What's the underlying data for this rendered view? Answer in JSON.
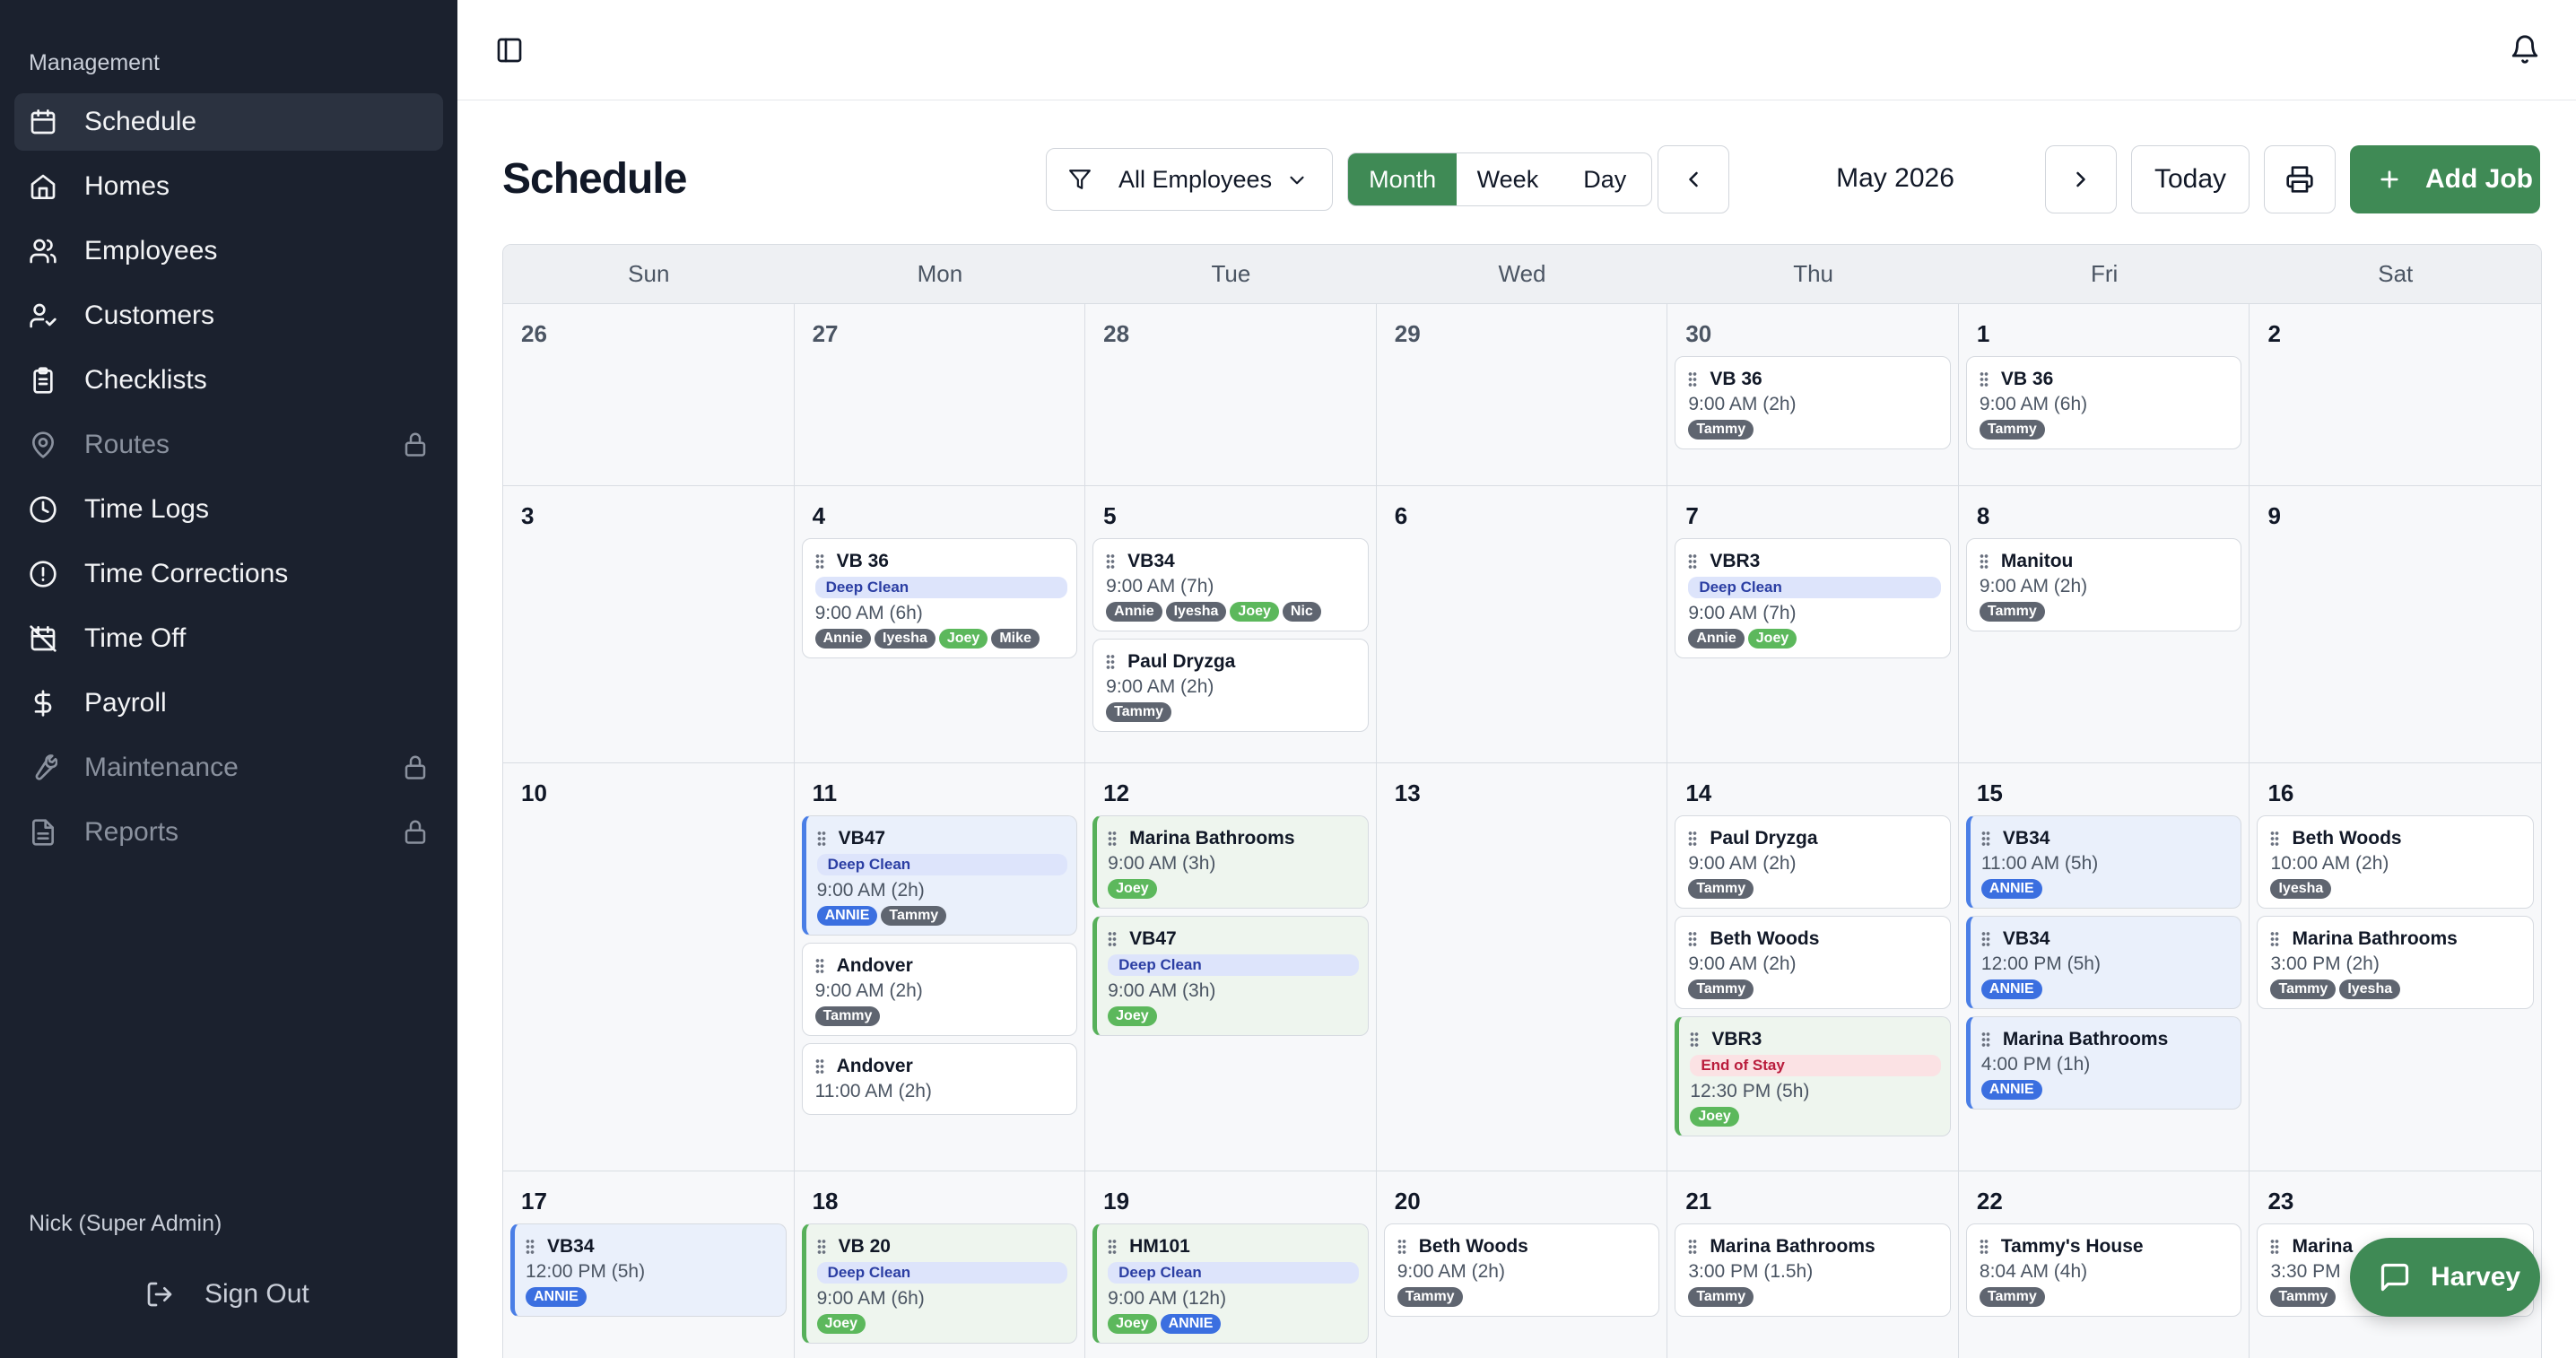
{
  "sidebar": {
    "section": "Management",
    "items": [
      {
        "label": "Schedule",
        "icon": "calendar-icon",
        "active": true,
        "locked": false
      },
      {
        "label": "Homes",
        "icon": "home-icon",
        "active": false,
        "locked": false
      },
      {
        "label": "Employees",
        "icon": "users-icon",
        "active": false,
        "locked": false
      },
      {
        "label": "Customers",
        "icon": "user-check-icon",
        "active": false,
        "locked": false
      },
      {
        "label": "Checklists",
        "icon": "clipboard-icon",
        "active": false,
        "locked": false
      },
      {
        "label": "Routes",
        "icon": "map-pin-icon",
        "active": false,
        "locked": true
      },
      {
        "label": "Time Logs",
        "icon": "clock-icon",
        "active": false,
        "locked": false
      },
      {
        "label": "Time Corrections",
        "icon": "alert-circle-icon",
        "active": false,
        "locked": false
      },
      {
        "label": "Time Off",
        "icon": "calendar-off-icon",
        "active": false,
        "locked": false
      },
      {
        "label": "Payroll",
        "icon": "dollar-icon",
        "active": false,
        "locked": false
      },
      {
        "label": "Maintenance",
        "icon": "wrench-icon",
        "active": false,
        "locked": true
      },
      {
        "label": "Reports",
        "icon": "file-text-icon",
        "active": false,
        "locked": true
      }
    ],
    "user": "Nick (Super Admin)",
    "sign_out": "Sign Out"
  },
  "header": {
    "title": "Schedule",
    "filter_label": "All Employees",
    "views": [
      "Month",
      "Week",
      "Day"
    ],
    "active_view": "Month",
    "period": "May 2026",
    "today_label": "Today",
    "add_job_label": "Add Job"
  },
  "calendar": {
    "weekdays": [
      "Sun",
      "Mon",
      "Tue",
      "Wed",
      "Thu",
      "Fri",
      "Sat"
    ],
    "weeks": [
      {
        "days": [
          {
            "num": "26",
            "other": true,
            "events": []
          },
          {
            "num": "27",
            "other": true,
            "events": []
          },
          {
            "num": "28",
            "other": true,
            "events": []
          },
          {
            "num": "29",
            "other": true,
            "events": []
          },
          {
            "num": "30",
            "other": true,
            "events": [
              {
                "title": "VB 36",
                "time": "9:00 AM (2h)",
                "tags": [
                  {
                    "name": "Tammy",
                    "color": "gray"
                  }
                ]
              }
            ]
          },
          {
            "num": "1",
            "events": [
              {
                "title": "VB 36",
                "time": "9:00 AM (6h)",
                "tags": [
                  {
                    "name": "Tammy",
                    "color": "gray"
                  }
                ]
              }
            ]
          },
          {
            "num": "2",
            "events": []
          }
        ]
      },
      {
        "days": [
          {
            "num": "3",
            "events": []
          },
          {
            "num": "4",
            "events": [
              {
                "title": "VB 36",
                "type": "Deep Clean",
                "type_style": "deep",
                "time": "9:00 AM (6h)",
                "tags": [
                  {
                    "name": "Annie",
                    "color": "gray"
                  },
                  {
                    "name": "Iyesha",
                    "color": "gray"
                  },
                  {
                    "name": "Joey",
                    "color": "green"
                  },
                  {
                    "name": "Mike",
                    "color": "gray"
                  }
                ]
              }
            ]
          },
          {
            "num": "5",
            "events": [
              {
                "title": "VB34",
                "time": "9:00 AM (7h)",
                "tags": [
                  {
                    "name": "Annie",
                    "color": "gray"
                  },
                  {
                    "name": "Iyesha",
                    "color": "gray"
                  },
                  {
                    "name": "Joey",
                    "color": "green"
                  },
                  {
                    "name": "Nic",
                    "color": "gray"
                  }
                ]
              },
              {
                "title": "Paul Dryzga",
                "time": "9:00 AM (2h)",
                "tags": [
                  {
                    "name": "Tammy",
                    "color": "gray"
                  }
                ]
              }
            ]
          },
          {
            "num": "6",
            "events": []
          },
          {
            "num": "7",
            "events": [
              {
                "title": "VBR3",
                "type": "Deep Clean",
                "type_style": "deep",
                "time": "9:00 AM (7h)",
                "tags": [
                  {
                    "name": "Annie",
                    "color": "gray"
                  },
                  {
                    "name": "Joey",
                    "color": "green"
                  }
                ]
              }
            ]
          },
          {
            "num": "8",
            "events": [
              {
                "title": "Manitou",
                "time": "9:00 AM (2h)",
                "tags": [
                  {
                    "name": "Tammy",
                    "color": "gray"
                  }
                ]
              }
            ]
          },
          {
            "num": "9",
            "events": []
          }
        ]
      },
      {
        "days": [
          {
            "num": "10",
            "events": []
          },
          {
            "num": "11",
            "events": [
              {
                "title": "VB47",
                "type": "Deep Clean",
                "type_style": "deep",
                "time": "9:00 AM (2h)",
                "style": "blue",
                "tags": [
                  {
                    "name": "ANNIE",
                    "color": "blue"
                  },
                  {
                    "name": "Tammy",
                    "color": "gray"
                  }
                ]
              },
              {
                "title": "Andover",
                "time": "9:00 AM (2h)",
                "tags": [
                  {
                    "name": "Tammy",
                    "color": "gray"
                  }
                ]
              },
              {
                "title": "Andover",
                "time": "11:00 AM (2h)",
                "tags": []
              }
            ]
          },
          {
            "num": "12",
            "events": [
              {
                "title": "Marina Bathrooms",
                "time": "9:00 AM (3h)",
                "style": "green",
                "tags": [
                  {
                    "name": "Joey",
                    "color": "green"
                  }
                ]
              },
              {
                "title": "VB47",
                "type": "Deep Clean",
                "type_style": "deep",
                "time": "9:00 AM (3h)",
                "style": "green",
                "tags": [
                  {
                    "name": "Joey",
                    "color": "green"
                  }
                ]
              }
            ]
          },
          {
            "num": "13",
            "events": []
          },
          {
            "num": "14",
            "events": [
              {
                "title": "Paul Dryzga",
                "time": "9:00 AM (2h)",
                "tags": [
                  {
                    "name": "Tammy",
                    "color": "gray"
                  }
                ]
              },
              {
                "title": "Beth Woods",
                "time": "9:00 AM (2h)",
                "tags": [
                  {
                    "name": "Tammy",
                    "color": "gray"
                  }
                ]
              },
              {
                "title": "VBR3",
                "type": "End of Stay",
                "type_style": "stay",
                "time": "12:30 PM (5h)",
                "style": "green",
                "tags": [
                  {
                    "name": "Joey",
                    "color": "green"
                  }
                ]
              }
            ]
          },
          {
            "num": "15",
            "events": [
              {
                "title": "VB34",
                "time": "11:00 AM (5h)",
                "style": "blue",
                "tags": [
                  {
                    "name": "ANNIE",
                    "color": "blue"
                  }
                ]
              },
              {
                "title": "VB34",
                "time": "12:00 PM (5h)",
                "style": "blue",
                "tags": [
                  {
                    "name": "ANNIE",
                    "color": "blue"
                  }
                ]
              },
              {
                "title": "Marina Bathrooms",
                "time": "4:00 PM (1h)",
                "style": "blue",
                "tags": [
                  {
                    "name": "ANNIE",
                    "color": "blue"
                  }
                ]
              }
            ]
          },
          {
            "num": "16",
            "events": [
              {
                "title": "Beth Woods",
                "time": "10:00 AM (2h)",
                "tags": [
                  {
                    "name": "Iyesha",
                    "color": "gray"
                  }
                ]
              },
              {
                "title": "Marina Bathrooms",
                "time": "3:00 PM (2h)",
                "tags": [
                  {
                    "name": "Tammy",
                    "color": "gray"
                  },
                  {
                    "name": "Iyesha",
                    "color": "gray"
                  }
                ]
              }
            ]
          }
        ]
      },
      {
        "days": [
          {
            "num": "17",
            "events": [
              {
                "title": "VB34",
                "time": "12:00 PM (5h)",
                "style": "blue",
                "tags": [
                  {
                    "name": "ANNIE",
                    "color": "blue"
                  }
                ]
              }
            ]
          },
          {
            "num": "18",
            "events": [
              {
                "title": "VB 20",
                "type": "Deep Clean",
                "type_style": "deep",
                "time": "9:00 AM (6h)",
                "style": "green",
                "tags": [
                  {
                    "name": "Joey",
                    "color": "green"
                  }
                ]
              }
            ]
          },
          {
            "num": "19",
            "events": [
              {
                "title": "HM101",
                "type": "Deep Clean",
                "type_style": "deep",
                "time": "9:00 AM (12h)",
                "style": "green",
                "tags": [
                  {
                    "name": "Joey",
                    "color": "green"
                  },
                  {
                    "name": "ANNIE",
                    "color": "blue"
                  }
                ]
              }
            ]
          },
          {
            "num": "20",
            "events": [
              {
                "title": "Beth Woods",
                "time": "9:00 AM (2h)",
                "tags": [
                  {
                    "name": "Tammy",
                    "color": "gray"
                  }
                ]
              }
            ]
          },
          {
            "num": "21",
            "events": [
              {
                "title": "Marina Bathrooms",
                "time": "3:00 PM (1.5h)",
                "tags": [
                  {
                    "name": "Tammy",
                    "color": "gray"
                  }
                ]
              }
            ]
          },
          {
            "num": "22",
            "events": [
              {
                "title": "Tammy's House",
                "time": "8:04 AM (4h)",
                "tags": [
                  {
                    "name": "Tammy",
                    "color": "gray"
                  }
                ]
              }
            ]
          },
          {
            "num": "23",
            "events": [
              {
                "title": "Marina",
                "time": "3:30 PM",
                "tags": [
                  {
                    "name": "Tammy",
                    "color": "gray"
                  }
                ]
              }
            ]
          }
        ]
      }
    ]
  },
  "assistant": {
    "label": "Harvey"
  },
  "colors": {
    "accent": "#3f8a55",
    "sidebar": "#1b212e",
    "tag_gray": "#5f6570",
    "tag_green": "#5cb85c",
    "tag_blue": "#3b6fe0"
  }
}
